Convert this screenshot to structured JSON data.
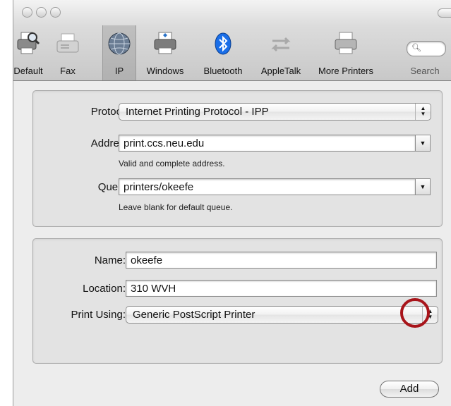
{
  "toolbar": {
    "items": [
      {
        "label": "Default",
        "icon": "printer-icon"
      },
      {
        "label": "Fax",
        "icon": "fax-icon"
      },
      {
        "label": "IP",
        "icon": "globe-icon",
        "selected": true
      },
      {
        "label": "Windows",
        "icon": "printer-icon"
      },
      {
        "label": "Bluetooth",
        "icon": "bluetooth-icon"
      },
      {
        "label": "AppleTalk",
        "icon": "appletalk-arrows-icon"
      },
      {
        "label": "More Printers",
        "icon": "printer-icon"
      }
    ],
    "search_label": "Search",
    "search_icon": "magnifier-icon"
  },
  "connection": {
    "protocol_label": "Protocol:",
    "protocol_value": "Internet Printing Protocol - IPP",
    "address_label": "Address:",
    "address_value": "print.ccs.neu.edu",
    "address_hint": "Valid and complete address.",
    "queue_label": "Queue:",
    "queue_value": "printers/okeefe",
    "queue_hint": "Leave blank for default queue."
  },
  "printer": {
    "name_label": "Name:",
    "name_value": "okeefe",
    "location_label": "Location:",
    "location_value": "310 WVH",
    "print_using_label": "Print Using:",
    "print_using_value": "Generic PostScript Printer"
  },
  "add_label": "Add",
  "colors": {
    "window_bg": "#ededed",
    "highlight_ring": "#a8141a",
    "bluetooth_blue": "#1a6ee8"
  }
}
